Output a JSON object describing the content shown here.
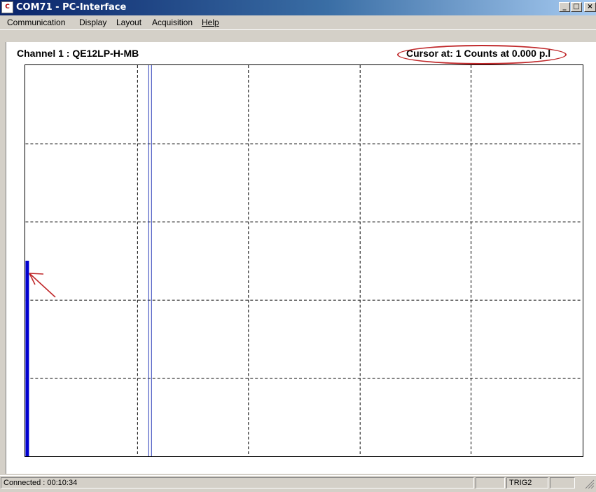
{
  "window": {
    "title": "COM71 - PC-Interface",
    "app_icon_text": "C",
    "minimize_glyph": "_",
    "maximize_glyph": "□",
    "close_glyph": "×"
  },
  "menu": {
    "items": [
      {
        "label": "Communication"
      },
      {
        "label": "Display"
      },
      {
        "label": "Layout"
      },
      {
        "label": "Acquisition"
      },
      {
        "label": "Help"
      }
    ]
  },
  "channel": {
    "label": "Channel 1 : QE12LP-H-MB",
    "cursor_readout": "Cursor at: 1 Counts at  0.000 p.l"
  },
  "chart_data": {
    "type": "bar",
    "title": "",
    "xlabel": "",
    "ylabel": "",
    "grid": true,
    "grid_divisions": {
      "x": 5,
      "y": 5
    },
    "x_range": [
      0,
      100
    ],
    "y_range": [
      0,
      100
    ],
    "x": [
      0
    ],
    "values": [
      50
    ],
    "cursor_x": 22,
    "color": "#0000d0",
    "cursor_color": "#2a3db8"
  },
  "annotations": {
    "highlight_color": "#c0282a",
    "arrow_color": "#c0282a"
  },
  "status": {
    "connection": "Connected : 00:10:34",
    "trigger": "TRIG2",
    "pane_empty_1": "",
    "pane_empty_2": ""
  }
}
